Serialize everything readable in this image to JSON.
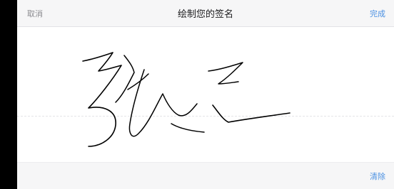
{
  "header": {
    "cancel_label": "取消",
    "title": "绘制您的签名",
    "done_label": "完成"
  },
  "footer": {
    "clear_label": "清除"
  },
  "colors": {
    "accent": "#4a90e2",
    "muted_text": "#8b8b90",
    "bar_background": "#f6f6f7",
    "ink": "#000000"
  }
}
